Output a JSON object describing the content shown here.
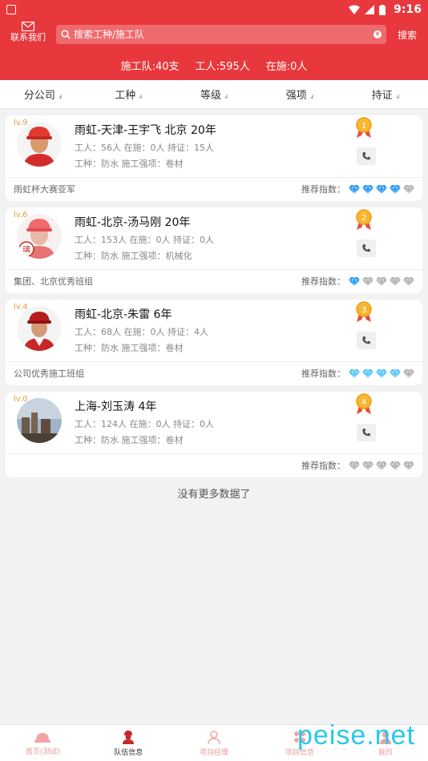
{
  "status_bar": {
    "time": "9:16"
  },
  "header": {
    "contact_label": "联系我们",
    "search_placeholder": "搜索工种/施工队",
    "search_button": "搜索"
  },
  "summary": {
    "teams": "施工队:40支",
    "workers": "工人:595人",
    "active": "在施:0人"
  },
  "filters": [
    "分公司",
    "工种",
    "等级",
    "强项",
    "持证"
  ],
  "teams": [
    {
      "level": "lv.9",
      "name": "雨虹-天津-王宇飞  北京 20年",
      "stats": "工人：56人 在施：0人 持证：15人",
      "skills": "工种：防水    施工强项：卷材",
      "honor": "雨虹杯大赛亚军",
      "rank": "1",
      "rec_label": "推荐指数：",
      "rating": 4,
      "gem_color": "#2196f3"
    },
    {
      "level": "lv.6",
      "name": "雨虹-北京-汤马刚   20年",
      "stats": "工人：153人 在施：0人 持证：0人",
      "skills": "工种：防水    施工强项：机械化",
      "honor": "集团、北京优秀班组",
      "rank": "2",
      "rec_label": "推荐指数：",
      "rating": 1,
      "gem_color": "#2196f3"
    },
    {
      "level": "lv.4",
      "name": "雨虹-北京-朱雷   6年",
      "stats": "工人：68人 在施：0人 持证：4人",
      "skills": "工种：防水    施工强项：卷材",
      "honor": "公司优秀施工班组",
      "rank": "3",
      "rec_label": "推荐指数：",
      "rating": 4,
      "gem_color": "#4fc3f7"
    },
    {
      "level": "lv.0",
      "name": "上海-刘玉涛   4年",
      "stats": "工人：124人 在施：0人 持证：0人",
      "skills": "工种：防水    施工强项：卷材",
      "honor": "",
      "rank": "4",
      "rec_label": "推荐指数：",
      "rating": 0,
      "gem_color": "#2196f3"
    }
  ],
  "no_more": "没有更多数据了",
  "tabbar": [
    {
      "label": "首页(测试)",
      "icon": "home-icon",
      "active": false
    },
    {
      "label": "队伍信息",
      "icon": "team-icon",
      "active": true
    },
    {
      "label": "项目经理",
      "icon": "manager-icon",
      "active": false
    },
    {
      "label": "项目信息",
      "icon": "project-icon",
      "active": false
    },
    {
      "label": "我的",
      "icon": "profile-icon",
      "active": false
    }
  ],
  "watermark": "peise.net",
  "colors": {
    "primary": "#e8383d",
    "gem_gray": "#b0b0b0",
    "level": "#f0973a",
    "watermark": "#28c8e8"
  }
}
